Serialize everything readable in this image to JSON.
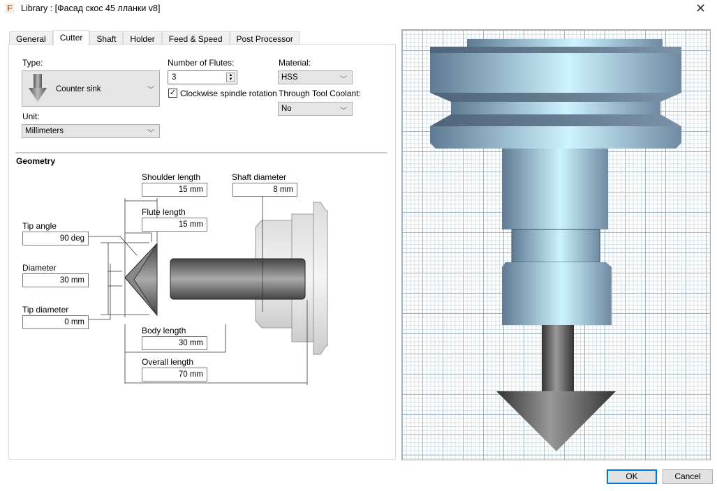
{
  "window": {
    "title": "Library : [Фасад скос 45 лланки v8]",
    "app_icon": "F"
  },
  "tabs": [
    {
      "label": "General"
    },
    {
      "label": "Cutter"
    },
    {
      "label": "Shaft"
    },
    {
      "label": "Holder"
    },
    {
      "label": "Feed & Speed"
    },
    {
      "label": "Post Processor"
    }
  ],
  "active_tab": "Cutter",
  "cutter": {
    "type_label": "Type:",
    "type_value": "Counter sink",
    "unit_label": "Unit:",
    "unit_value": "Millimeters",
    "flutes_label": "Number of Flutes:",
    "flutes_value": "3",
    "clockwise_label": "Clockwise spindle rotation",
    "clockwise_checked": true,
    "material_label": "Material:",
    "material_value": "HSS",
    "coolant_label": "Through Tool Coolant:",
    "coolant_value": "No"
  },
  "geometry": {
    "heading": "Geometry",
    "shoulder_length": {
      "label": "Shoulder length",
      "value": "15 mm"
    },
    "shaft_diameter": {
      "label": "Shaft diameter",
      "value": "8 mm"
    },
    "flute_length": {
      "label": "Flute length",
      "value": "15 mm"
    },
    "tip_angle": {
      "label": "Tip angle",
      "value": "90 deg"
    },
    "diameter": {
      "label": "Diameter",
      "value": "30 mm"
    },
    "tip_diameter": {
      "label": "Tip diameter",
      "value": "0 mm"
    },
    "body_length": {
      "label": "Body length",
      "value": "30 mm"
    },
    "overall_length": {
      "label": "Overall length",
      "value": "70 mm"
    }
  },
  "buttons": {
    "ok": "OK",
    "cancel": "Cancel"
  }
}
